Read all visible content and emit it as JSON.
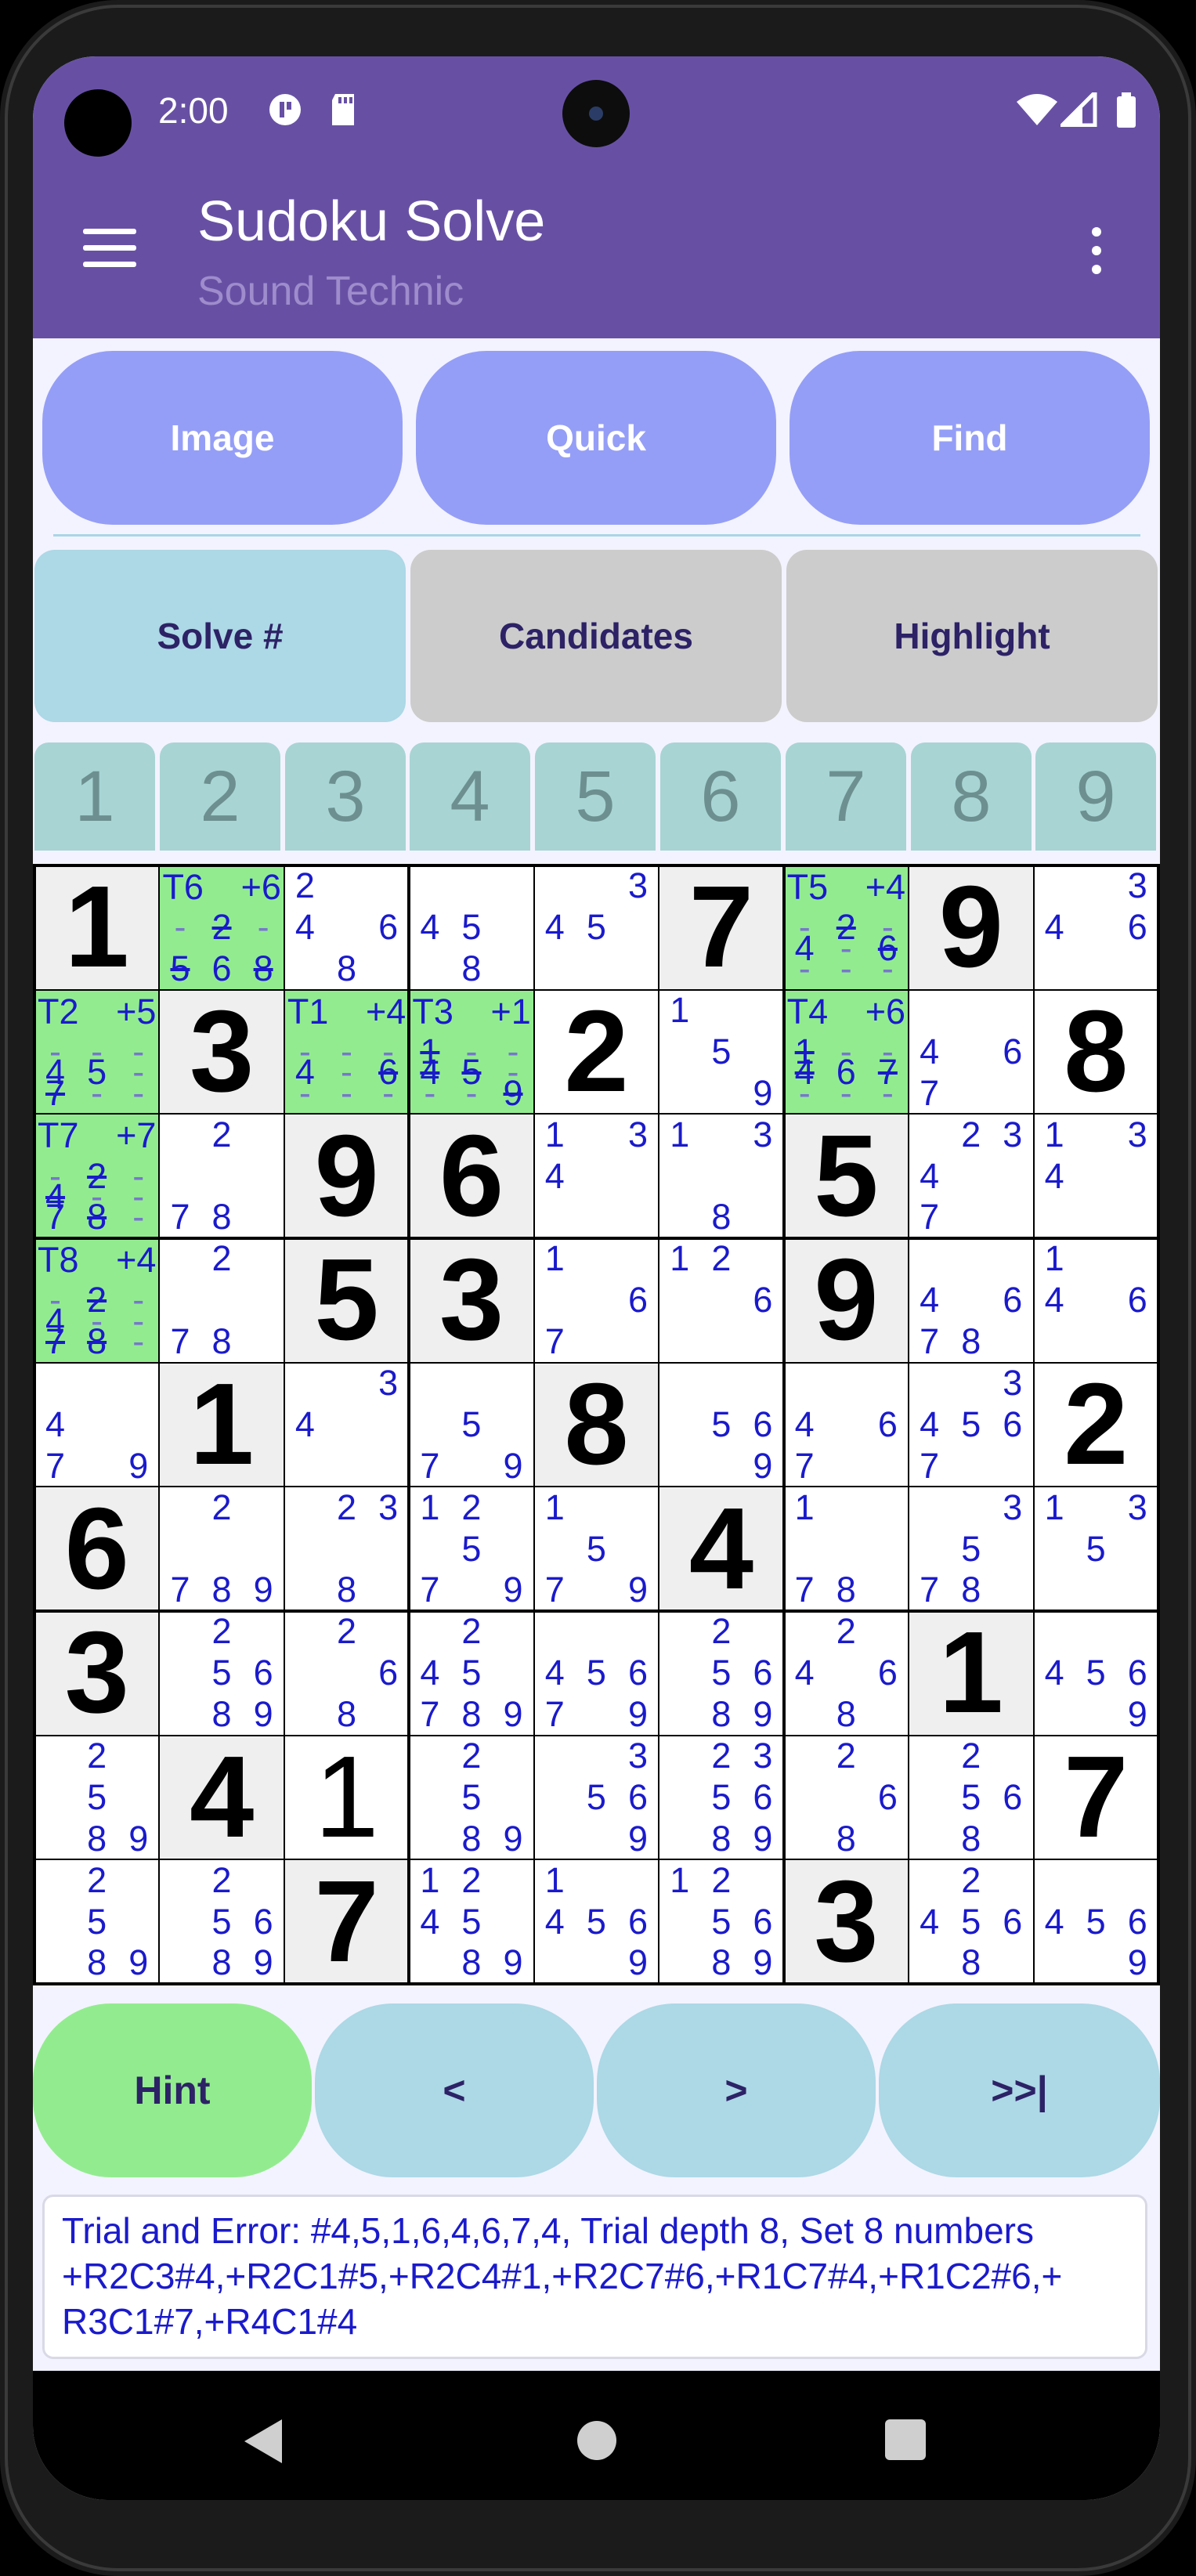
{
  "status": {
    "time": "2:00"
  },
  "appbar": {
    "title": "Sudoku Solve",
    "subtitle": "Sound Technic"
  },
  "top_buttons": [
    "Image",
    "Quick",
    "Find"
  ],
  "mid_buttons": [
    {
      "label": "Solve #",
      "color": "#add8e6"
    },
    {
      "label": "Candidates",
      "color": "#cccccc"
    },
    {
      "label": "Highlight",
      "color": "#cccccc"
    }
  ],
  "digits": [
    "1",
    "2",
    "3",
    "4",
    "5",
    "6",
    "7",
    "8",
    "9"
  ],
  "grid": [
    [
      {
        "v": "1",
        "g": 1
      },
      {
        "t": 1,
        "tl": "T6",
        "tr": "+6",
        "c": [
          "-",
          "2s",
          "-",
          "5s",
          "6",
          "8s"
        ],
        "m": [
          0,
          1,
          2,
          6,
          7,
          8
        ]
      },
      {
        "c": [
          "2",
          "",
          "",
          "4",
          "",
          "6",
          "",
          "8",
          ""
        ]
      },
      {
        "c": [
          "",
          "",
          "",
          "4",
          "5",
          "",
          "",
          "8",
          ""
        ]
      },
      {
        "c": [
          "",
          "",
          "3",
          "4",
          "5",
          "",
          "",
          "",
          ""
        ]
      },
      {
        "v": "7",
        "g": 1
      },
      {
        "t": 1,
        "tl": "T5",
        "tr": "+4",
        "c": [
          "-",
          "2s",
          "-",
          "4",
          "-",
          "6s",
          "-",
          "-",
          "-"
        ],
        "m": [
          3,
          4,
          5,
          6,
          7,
          8,
          9,
          10,
          11
        ]
      },
      {
        "v": "9",
        "g": 1
      },
      {
        "c": [
          "",
          "",
          "3",
          "4",
          "",
          "6",
          "",
          "",
          ""
        ]
      }
    ],
    [
      {
        "t": 1,
        "tl": "T2",
        "tr": "+5",
        "c": [
          "-",
          "-",
          "-",
          "4",
          "5",
          "-",
          "7s",
          "-",
          "-"
        ],
        "m": [
          3,
          4,
          5,
          6,
          7,
          8,
          9,
          10,
          11
        ]
      },
      {
        "v": "3",
        "g": 1
      },
      {
        "t": 1,
        "tl": "T1",
        "tr": "+4",
        "c": [
          "-",
          "-",
          "-",
          "4",
          "-",
          "6s",
          "-",
          "-",
          "-"
        ],
        "m": [
          3,
          4,
          5,
          6,
          7,
          8,
          9,
          10,
          11
        ]
      },
      {
        "t": 1,
        "tl": "T3",
        "tr": "+1",
        "c": [
          "1s",
          "-",
          "-",
          "4s",
          "5s",
          "-",
          "-",
          "-",
          "9s"
        ],
        "m": [
          3,
          4,
          5,
          6,
          7,
          8,
          9,
          10,
          11
        ]
      },
      {
        "v": "2",
        "g": 0
      },
      {
        "c": [
          "1",
          "",
          "",
          "",
          "5",
          "",
          "",
          "",
          "9"
        ]
      },
      {
        "t": 1,
        "tl": "T4",
        "tr": "+6",
        "c": [
          "1s",
          "-",
          "-",
          "4s",
          "6",
          "7s",
          "-",
          "-",
          "-"
        ],
        "m": [
          3,
          4,
          5,
          6,
          7,
          8,
          9,
          10,
          11
        ]
      },
      {
        "c": [
          "",
          "",
          "",
          "4",
          "",
          "6",
          "7",
          "",
          ""
        ]
      },
      {
        "v": "8",
        "g": 0
      }
    ],
    [
      {
        "t": 1,
        "tl": "T7",
        "tr": "+7",
        "c": [
          "-",
          "2s",
          "-",
          "4s",
          "-",
          "-",
          "7",
          "8s",
          "-"
        ],
        "m": [
          3,
          4,
          5,
          6,
          7,
          8,
          9,
          10,
          11
        ]
      },
      {
        "c": [
          "",
          "2",
          "",
          "",
          "",
          "",
          "7",
          "8",
          ""
        ]
      },
      {
        "v": "9",
        "g": 1
      },
      {
        "v": "6",
        "g": 1
      },
      {
        "c": [
          "1",
          "",
          "3",
          "4",
          "",
          "",
          "",
          "",
          ""
        ]
      },
      {
        "c": [
          "1",
          "",
          "3",
          "",
          "",
          "",
          "",
          "8",
          ""
        ]
      },
      {
        "v": "5",
        "g": 1
      },
      {
        "c": [
          "",
          "2",
          "3",
          "4",
          "",
          "",
          "7",
          "",
          ""
        ]
      },
      {
        "c": [
          "1",
          "",
          "3",
          "4",
          "",
          "",
          "",
          "",
          ""
        ]
      }
    ],
    [
      {
        "t": 1,
        "tl": "T8",
        "tr": "+4",
        "c": [
          "-",
          "2s",
          "-",
          "4",
          "-",
          "-",
          "7s",
          "8s",
          "-"
        ],
        "m": [
          3,
          4,
          5,
          6,
          7,
          8,
          9,
          10,
          11
        ]
      },
      {
        "c": [
          "",
          "2",
          "",
          "",
          "",
          "",
          "7",
          "8",
          ""
        ]
      },
      {
        "v": "5",
        "g": 1
      },
      {
        "v": "3",
        "g": 1
      },
      {
        "c": [
          "1",
          "",
          "",
          "",
          "",
          "6",
          "7",
          "",
          ""
        ]
      },
      {
        "c": [
          "1",
          "2",
          "",
          "",
          "",
          "6",
          "",
          "",
          ""
        ]
      },
      {
        "v": "9",
        "g": 1
      },
      {
        "c": [
          "",
          "",
          "",
          "4",
          "",
          "6",
          "7",
          "8",
          ""
        ]
      },
      {
        "c": [
          "1",
          "",
          "",
          "4",
          "",
          "6",
          "",
          "",
          ""
        ]
      }
    ],
    [
      {
        "c": [
          "",
          "",
          "",
          "4",
          "",
          "",
          "7",
          "",
          "9"
        ]
      },
      {
        "v": "1",
        "g": 1
      },
      {
        "c": [
          "",
          "",
          "3",
          "4",
          "",
          "",
          "",
          "",
          ""
        ]
      },
      {
        "c": [
          "",
          "",
          "",
          "",
          "5",
          "",
          "7",
          "",
          "9"
        ]
      },
      {
        "v": "8",
        "g": 1
      },
      {
        "c": [
          "",
          "",
          "",
          "",
          "5",
          "6",
          "",
          "",
          "9"
        ]
      },
      {
        "c": [
          "",
          "",
          "",
          "4",
          "",
          "6",
          "7",
          "",
          ""
        ]
      },
      {
        "c": [
          "",
          "",
          "3",
          "4",
          "5",
          "6",
          "7",
          "",
          ""
        ]
      },
      {
        "v": "2",
        "g": 0
      }
    ],
    [
      {
        "v": "6",
        "g": 1
      },
      {
        "c": [
          "",
          "2",
          "",
          "",
          "",
          "",
          "7",
          "8",
          "9"
        ]
      },
      {
        "c": [
          "",
          "2",
          "3",
          "",
          "",
          "",
          "",
          "8",
          ""
        ]
      },
      {
        "c": [
          "1",
          "2",
          "",
          "",
          "5",
          "",
          "7",
          "",
          "9"
        ]
      },
      {
        "c": [
          "1",
          "",
          "",
          "",
          "5",
          "",
          "7",
          "",
          "9"
        ]
      },
      {
        "v": "4",
        "g": 1
      },
      {
        "c": [
          "1",
          "",
          "",
          "",
          "",
          "",
          "7",
          "8",
          ""
        ]
      },
      {
        "c": [
          "",
          "",
          "3",
          "",
          "5",
          "",
          "7",
          "8",
          ""
        ]
      },
      {
        "c": [
          "1",
          "",
          "3",
          "",
          "5",
          "",
          "",
          "",
          ""
        ]
      }
    ],
    [
      {
        "v": "3",
        "g": 1
      },
      {
        "c": [
          "",
          "2",
          "",
          "",
          "5",
          "6",
          "",
          "8",
          "9"
        ]
      },
      {
        "c": [
          "",
          "2",
          "",
          "",
          "",
          "6",
          "",
          "8",
          ""
        ]
      },
      {
        "c": [
          "",
          "2",
          "",
          "4",
          "5",
          "",
          "7",
          "8",
          "9"
        ]
      },
      {
        "c": [
          "",
          "",
          "",
          "4",
          "5",
          "6",
          "7",
          "",
          "9"
        ]
      },
      {
        "c": [
          "",
          "2",
          "",
          "",
          "5",
          "6",
          "",
          "8",
          "9"
        ]
      },
      {
        "c": [
          "",
          "2",
          "",
          "4",
          "",
          "6",
          "",
          "8",
          ""
        ]
      },
      {
        "v": "1",
        "g": 1
      },
      {
        "c": [
          "",
          "",
          "",
          "4",
          "5",
          "6",
          "",
          "",
          "9"
        ]
      }
    ],
    [
      {
        "c": [
          "",
          "2",
          "",
          "",
          "5",
          "",
          "",
          "8",
          "9"
        ]
      },
      {
        "v": "4",
        "g": 1
      },
      {
        "v": "1",
        "g": 0,
        "p": 1
      },
      {
        "c": [
          "",
          "2",
          "",
          "",
          "5",
          "",
          "",
          "8",
          "9"
        ]
      },
      {
        "c": [
          "",
          "",
          "3",
          "",
          "5",
          "6",
          "",
          "",
          "9"
        ]
      },
      {
        "c": [
          "",
          "2",
          "3",
          "",
          "5",
          "6",
          "",
          "8",
          "9"
        ]
      },
      {
        "c": [
          "",
          "2",
          "",
          "",
          "",
          "6",
          "",
          "8",
          ""
        ]
      },
      {
        "c": [
          "",
          "2",
          "",
          "",
          "5",
          "6",
          "",
          "8",
          ""
        ]
      },
      {
        "v": "7",
        "g": 0
      }
    ],
    [
      {
        "c": [
          "",
          "2",
          "",
          "",
          "5",
          "",
          "",
          "8",
          "9"
        ]
      },
      {
        "c": [
          "",
          "2",
          "",
          "",
          "5",
          "6",
          "",
          "8",
          "9"
        ]
      },
      {
        "v": "7",
        "g": 1
      },
      {
        "c": [
          "1",
          "2",
          "",
          "4",
          "5",
          "",
          "",
          "8",
          "9"
        ]
      },
      {
        "c": [
          "1",
          "",
          "",
          "4",
          "5",
          "6",
          "",
          "",
          "9"
        ]
      },
      {
        "c": [
          "1",
          "2",
          "",
          "",
          "5",
          "6",
          "",
          "8",
          "9"
        ]
      },
      {
        "v": "3",
        "g": 1
      },
      {
        "c": [
          "",
          "2",
          "",
          "4",
          "5",
          "6",
          "",
          "8",
          ""
        ]
      },
      {
        "c": [
          "",
          "",
          "",
          "4",
          "5",
          "6",
          "",
          "",
          "9"
        ]
      }
    ]
  ],
  "bottom_buttons": [
    {
      "label": "Hint",
      "color": "#92ec8f"
    },
    {
      "label": "<",
      "color": "#add8e6"
    },
    {
      "label": ">",
      "color": "#add8e6"
    },
    {
      "label": ">>|",
      "color": "#add8e6"
    }
  ],
  "message": {
    "line1": "Trial and Error: #4,5,1,6,4,6,7,4, Trial depth 8, Set 8 numbers",
    "line2": "+R2C3#4,+R2C1#5,+R2C4#1,+R2C7#6,+R1C7#4,+R1C2#6,+",
    "line3": "R3C1#7,+R4C1#4"
  }
}
